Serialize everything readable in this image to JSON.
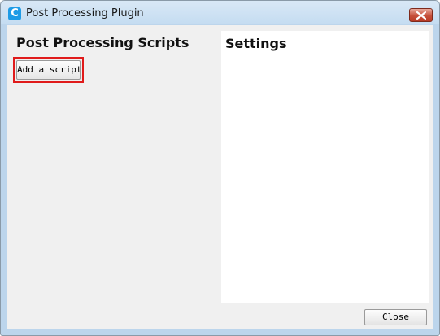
{
  "window": {
    "title": "Post Processing Plugin",
    "icon": "c-logo-icon",
    "close_icon": "close-icon"
  },
  "left_panel": {
    "title": "Post Processing Scripts",
    "add_script_label": "Add a script"
  },
  "settings_panel": {
    "title": "Settings"
  },
  "footer": {
    "close_label": "Close"
  },
  "colors": {
    "titlebar": "#c4dcf1",
    "client_background": "#f0f0f0",
    "highlight_border": "#e01b1b",
    "close_button_red": "#c7503b"
  }
}
